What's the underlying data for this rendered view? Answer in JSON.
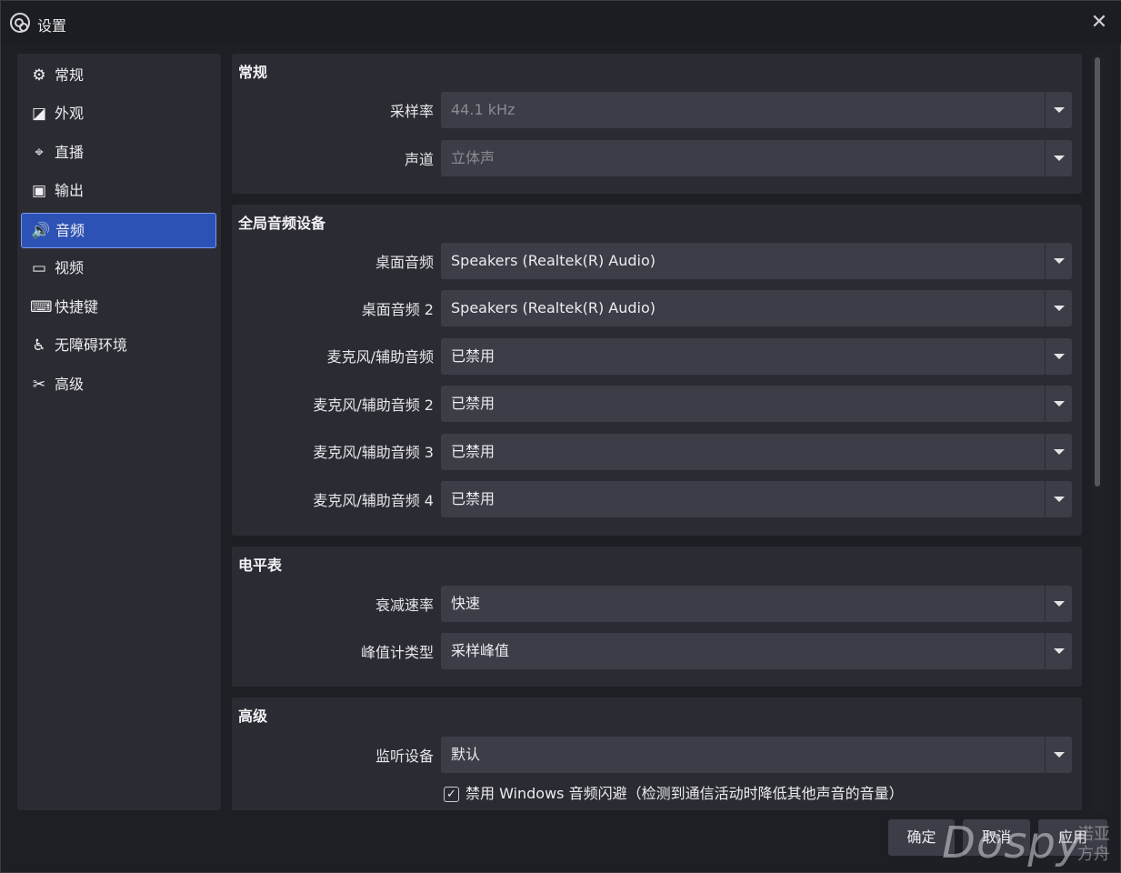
{
  "window": {
    "title": "设置",
    "close_glyph": "✕"
  },
  "sidebar": {
    "items": [
      {
        "label": "常规",
        "icon": "gear-icon",
        "glyph": "⚙"
      },
      {
        "label": "外观",
        "icon": "appearance-icon",
        "glyph": "◪"
      },
      {
        "label": "直播",
        "icon": "broadcast-antenna-icon",
        "glyph": "⌖"
      },
      {
        "label": "输出",
        "icon": "output-camera-icon",
        "glyph": "▣"
      },
      {
        "label": "音频",
        "icon": "speaker-icon",
        "glyph": "🔊"
      },
      {
        "label": "视频",
        "icon": "monitor-icon",
        "glyph": "▭"
      },
      {
        "label": "快捷键",
        "icon": "keyboard-icon",
        "glyph": "⌨"
      },
      {
        "label": "无障碍环境",
        "icon": "accessibility-icon",
        "glyph": "♿"
      },
      {
        "label": "高级",
        "icon": "tools-icon",
        "glyph": "✂"
      }
    ],
    "active_index": 4
  },
  "groups": {
    "general": {
      "title": "常规",
      "rows": [
        {
          "label": "采样率",
          "value": "44.1 kHz",
          "disabled": true
        },
        {
          "label": "声道",
          "value": "立体声",
          "disabled": true
        }
      ]
    },
    "global_devices": {
      "title": "全局音频设备",
      "rows": [
        {
          "label": "桌面音频",
          "value": "Speakers (Realtek(R) Audio)"
        },
        {
          "label": "桌面音频 2",
          "value": "Speakers (Realtek(R) Audio)"
        },
        {
          "label": "麦克风/辅助音频",
          "value": "已禁用"
        },
        {
          "label": "麦克风/辅助音频 2",
          "value": "已禁用"
        },
        {
          "label": "麦克风/辅助音频 3",
          "value": "已禁用"
        },
        {
          "label": "麦克风/辅助音频 4",
          "value": "已禁用"
        }
      ]
    },
    "meters": {
      "title": "电平表",
      "rows": [
        {
          "label": "衰减速率",
          "value": "快速"
        },
        {
          "label": "峰值计类型",
          "value": "采样峰值"
        }
      ]
    },
    "advanced": {
      "title": "高级",
      "rows": [
        {
          "label": "监听设备",
          "value": "默认"
        }
      ],
      "checkbox": {
        "label": "禁用 Windows 音频闪避（检测到通信活动时降低其他声音的音量）",
        "checked": true,
        "mark": "✓"
      }
    }
  },
  "buttons": {
    "ok": "确定",
    "cancel": "取消",
    "apply": "应用"
  },
  "watermark": {
    "brand": "Dospy",
    "line1": "诺亚",
    "line2": "方舟"
  }
}
